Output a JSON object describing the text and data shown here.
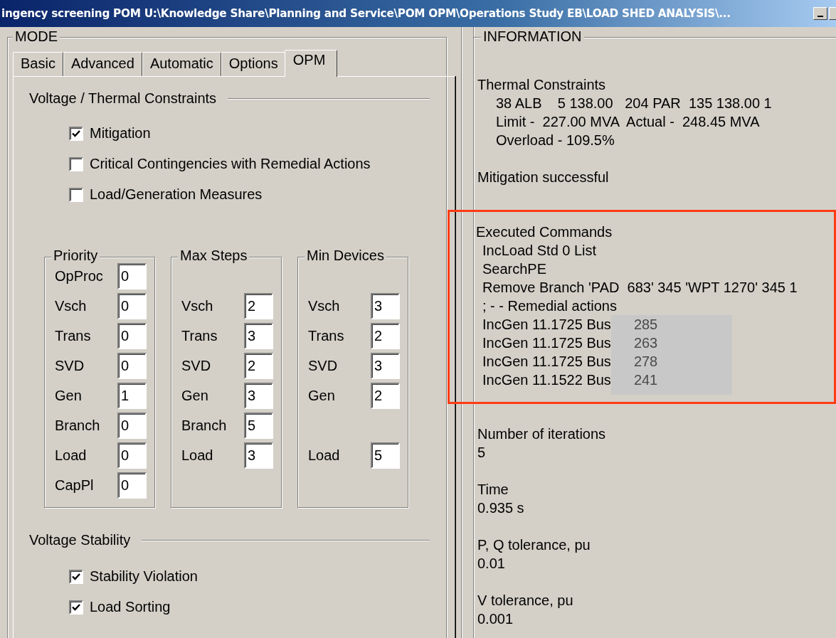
{
  "window": {
    "title": "ingency screening  POM  U:\\Knowledge Share\\Planning and Service\\POM OPM\\Operations Study EB\\LOAD SHED ANALYSIS\\..."
  },
  "mode": {
    "title": "MODE",
    "tabs": [
      {
        "label": "Basic",
        "selected": false
      },
      {
        "label": "Advanced",
        "selected": false
      },
      {
        "label": "Automatic",
        "selected": false
      },
      {
        "label": "Options",
        "selected": false
      },
      {
        "label": "OPM",
        "selected": true
      }
    ],
    "constraints": {
      "title": "Voltage / Thermal Constraints",
      "options": [
        {
          "label": "Mitigation",
          "checked": true
        },
        {
          "label": "Critical Contingencies with Remedial Actions",
          "checked": false
        },
        {
          "label": "Load/Generation Measures",
          "checked": false
        }
      ]
    },
    "groups": [
      {
        "title": "Priority",
        "fields": [
          {
            "kind": "field",
            "label": "OpProc",
            "value": "0"
          },
          {
            "kind": "field",
            "label": "Vsch",
            "value": "0"
          },
          {
            "kind": "field",
            "label": "Trans",
            "value": "0"
          },
          {
            "kind": "field",
            "label": "SVD",
            "value": "0"
          },
          {
            "kind": "field",
            "label": "Gen",
            "value": "1"
          },
          {
            "kind": "field",
            "label": "Branch",
            "value": "0"
          },
          {
            "kind": "field",
            "label": "Load",
            "value": "0"
          },
          {
            "kind": "field",
            "label": "CapPl",
            "value": "0"
          }
        ]
      },
      {
        "title": "Max Steps",
        "fields": [
          {
            "kind": "spacer"
          },
          {
            "kind": "field",
            "label": "Vsch",
            "value": "2"
          },
          {
            "kind": "field",
            "label": "Trans",
            "value": "3"
          },
          {
            "kind": "field",
            "label": "SVD",
            "value": "2"
          },
          {
            "kind": "field",
            "label": "Gen",
            "value": "3"
          },
          {
            "kind": "field",
            "label": "Branch",
            "value": "5"
          },
          {
            "kind": "field",
            "label": "Load",
            "value": "3"
          }
        ]
      },
      {
        "title": "Min Devices",
        "fields": [
          {
            "kind": "spacer"
          },
          {
            "kind": "field",
            "label": "Vsch",
            "value": "3"
          },
          {
            "kind": "field",
            "label": "Trans",
            "value": "2"
          },
          {
            "kind": "field",
            "label": "SVD",
            "value": "3"
          },
          {
            "kind": "field",
            "label": "Gen",
            "value": "2"
          },
          {
            "kind": "spacer"
          },
          {
            "kind": "field",
            "label": "Load",
            "value": "5"
          }
        ]
      }
    ],
    "stability": {
      "title": "Voltage Stability",
      "options": [
        {
          "label": "Stability Violation",
          "checked": true
        },
        {
          "label": "Load Sorting",
          "checked": true
        }
      ]
    }
  },
  "information": {
    "title": "INFORMATION",
    "sections": [
      {
        "heading": "Thermal Constraints",
        "lines": [
          "38 ALB    5 138.00   204 PAR  135 138.00 1",
          "Limit -  227.00 MVA  Actual -  248.45 MVA",
          "Overload - 109.5%"
        ]
      },
      {
        "heading": "Mitigation successful"
      },
      {
        "heading": "Executed Commands",
        "highlighted": true,
        "commands": [
          {
            "kind": "text",
            "text": "IncLoad Std 0 List"
          },
          {
            "kind": "text",
            "text": "SearchPE"
          },
          {
            "kind": "text",
            "text": "Remove Branch 'PAD  683' 345 'WPT 1270' 345 1"
          },
          {
            "kind": "text",
            "text": "; - - Remedial actions"
          },
          {
            "kind": "bus",
            "text": "IncGen 11.1725 Bus",
            "value": "285"
          },
          {
            "kind": "bus",
            "text": "IncGen 11.1725 Bus",
            "value": "263"
          },
          {
            "kind": "bus",
            "text": "IncGen 11.1725 Bus",
            "value": "278"
          },
          {
            "kind": "bus",
            "text": "IncGen 11.1522 Bus",
            "value": "241"
          }
        ]
      },
      {
        "heading": "Number of iterations",
        "value": "5"
      },
      {
        "heading": "Time",
        "value": "0.935 s"
      },
      {
        "heading": "P, Q tolerance, pu",
        "value": "0.01"
      },
      {
        "heading": "V tolerance, pu",
        "value": "0.001"
      }
    ]
  }
}
